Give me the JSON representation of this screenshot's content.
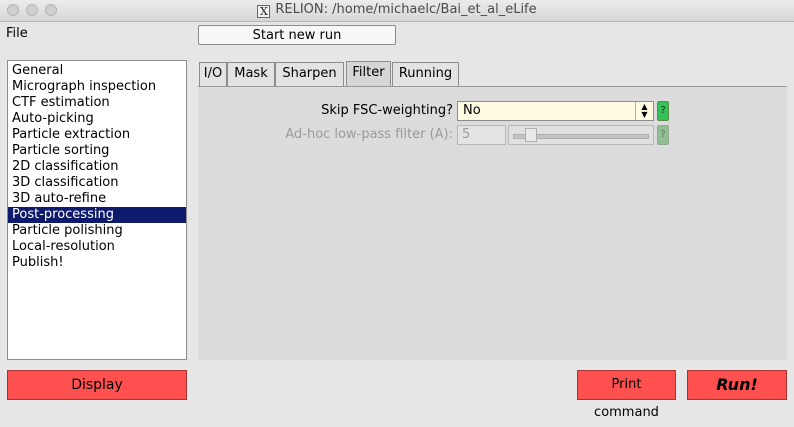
{
  "window": {
    "title": "RELION: /home/michaelc/Bai_et_al_eLife"
  },
  "menu": {
    "file": "File"
  },
  "toolbar": {
    "start_new_run": "Start new run"
  },
  "jobs": [
    "General",
    "Micrograph inspection",
    "CTF estimation",
    "Auto-picking",
    "Particle extraction",
    "Particle sorting",
    "2D classification",
    "3D classification",
    "3D auto-refine",
    "Post-processing",
    "Particle polishing",
    "Local-resolution",
    "Publish!"
  ],
  "selected_job": "Post-processing",
  "tabs": [
    "I/O",
    "Mask",
    "Sharpen",
    "Filter",
    "Running"
  ],
  "active_tab": "Filter",
  "fields": {
    "skip_fsc": {
      "label": "Skip FSC-weighting?",
      "value": "No",
      "help": "?"
    },
    "adhoc_lowpass": {
      "label": "Ad-hoc low-pass filter (A):",
      "value": "5",
      "slider_fraction": 0.1,
      "help": "?"
    }
  },
  "buttons": {
    "display": "Display",
    "print_command": "Print command",
    "run": "Run!"
  },
  "colors": {
    "selection": "#0e1a6b",
    "button_red": "#ff5050",
    "help_green": "#36c25a",
    "combo_bg": "#fffbe3"
  }
}
